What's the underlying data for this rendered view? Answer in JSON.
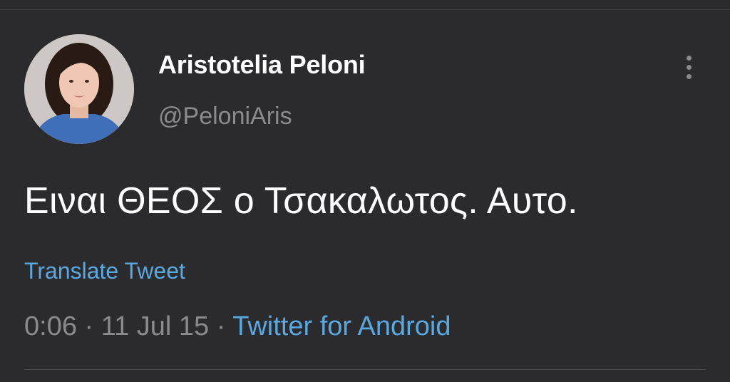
{
  "user": {
    "display_name": "Aristotelia Peloni",
    "handle": "@PeloniAris",
    "avatar_icon": "profile-photo"
  },
  "menu": {
    "icon": "vertical-ellipsis-icon"
  },
  "tweet": {
    "text": "Ειναι ΘΕΟΣ ο Τσακαλωτος. Αυτο.",
    "translate_label": "Translate Tweet",
    "time": "0:06",
    "separator": " · ",
    "date": "11 Jul 15",
    "client": "Twitter for Android"
  },
  "colors": {
    "background": "#2b2b2d",
    "text_primary": "#ffffff",
    "text_secondary": "#8b8b8f",
    "link": "#5aa8e0"
  }
}
